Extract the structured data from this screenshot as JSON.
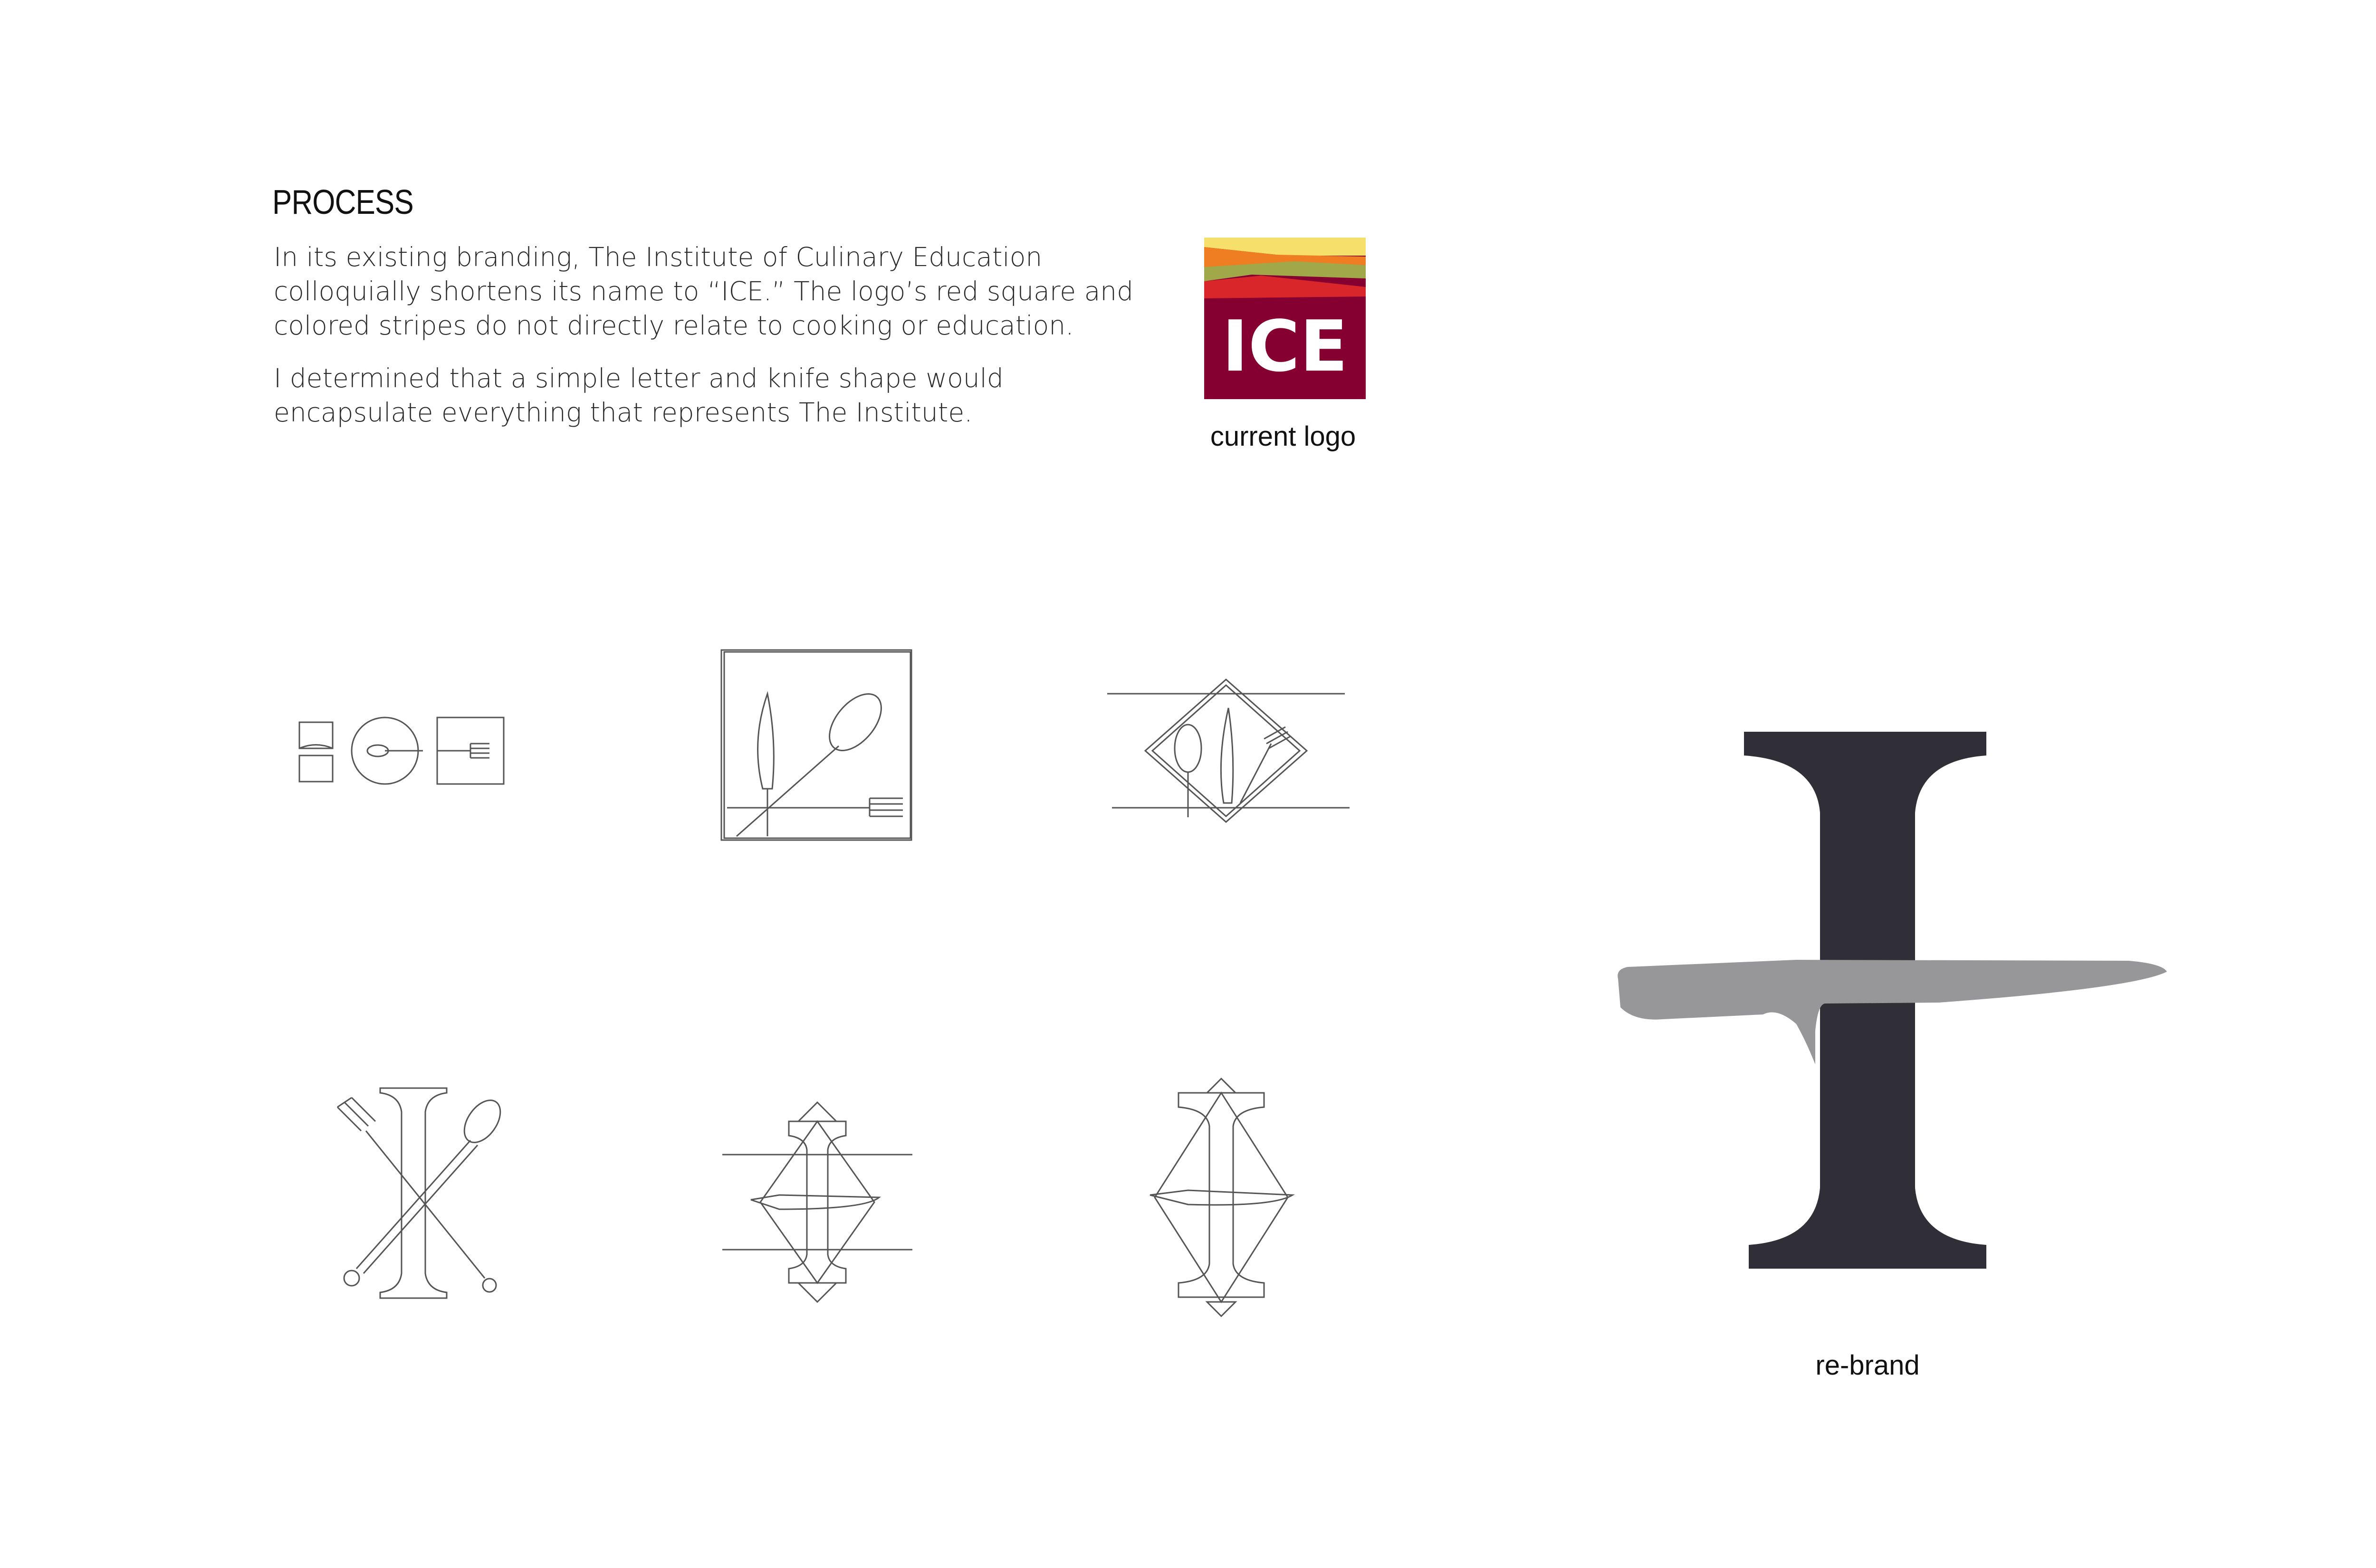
{
  "heading": "PROCESS",
  "paragraphs": [
    "In its existing branding, The Institute of Culinary Education\ncolloquially shortens its name to “ICE.” The logo’s red square and\ncolored stripes do not directly relate to cooking or education.",
    "I determined that a simple letter and knife shape would\nencapsulate everything that represents The Institute."
  ],
  "current_logo": {
    "text": "ICE",
    "caption": "current logo",
    "colors": {
      "square": "#850030",
      "stripe_yellow": "#f7df6b",
      "stripe_orange": "#ef7d22",
      "stripe_olive": "#a1a84a",
      "stripe_red": "#d9262a",
      "text": "#ffffff"
    }
  },
  "sketches": [
    {
      "name": "ice-letters-sketch"
    },
    {
      "name": "knife-spoon-fork-square-sketch"
    },
    {
      "name": "utensils-diamond-sketch"
    },
    {
      "name": "i-crossed-utensils-sketch"
    },
    {
      "name": "i-knife-diamond-sketch"
    },
    {
      "name": "i-knife-tall-diamond-sketch"
    }
  ],
  "rebrand": {
    "caption": "re-brand",
    "colors": {
      "letter": "#302f38",
      "knife": "#979699"
    }
  }
}
